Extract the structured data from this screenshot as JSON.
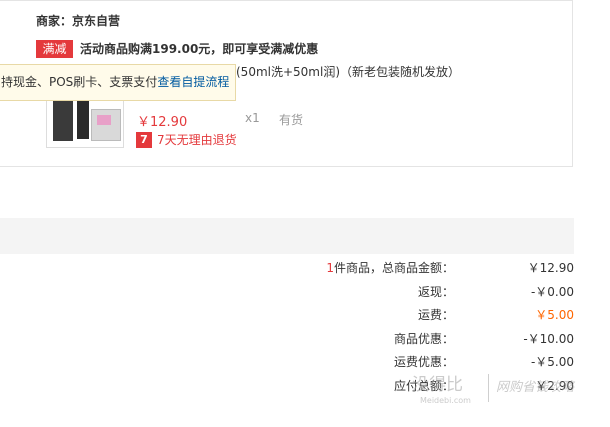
{
  "order": {
    "merchant": "商家：京东自营",
    "promo_badge": "满减",
    "promo_text": "活动商品购满199.00元，即可享受满减优惠",
    "product_name_partial": "(50ml洗+50ml润)（新老包装随机发放）",
    "price": "￥12.90",
    "qty": "x1",
    "stock": "有货",
    "return_icon": "7",
    "return_text": "7天无理由退货"
  },
  "tooltip": {
    "text": "持现金、POS刷卡、支票支付",
    "link": "查看自提流程"
  },
  "summary": {
    "count": "1",
    "count_suffix": "件商品，总商品金额：",
    "total_value": "￥12.90",
    "cashback_label": "返现：",
    "cashback_value": "-￥0.00",
    "shipping_label": "运费：",
    "shipping_value": "￥5.00",
    "discount_label": "商品优惠：",
    "discount_value": "-￥10.00",
    "shipping_discount_label": "运费优惠：",
    "shipping_discount_value": "-￥5.00",
    "payable_label": "应付总额：",
    "payable_value": "￥2.90"
  },
  "watermark": {
    "brand": "没得比",
    "domain": "Meidebi.com",
    "tagline": "网购省钱攻略"
  },
  "colors": {
    "accent_red": "#e4393c",
    "orange": "#ff6600",
    "link_blue": "#005aa0"
  }
}
